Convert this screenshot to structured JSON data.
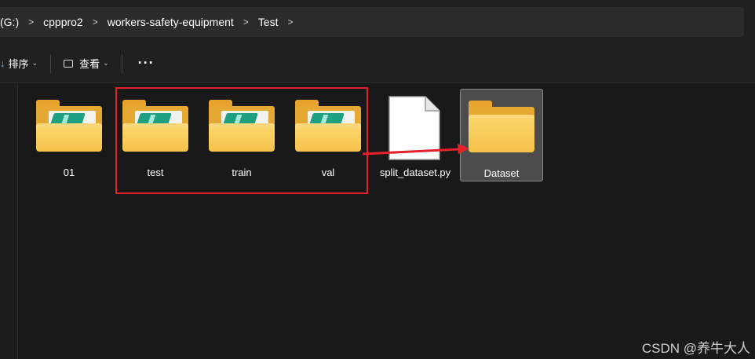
{
  "breadcrumb": {
    "items": [
      "(G:)",
      "cpppro2",
      "workers-safety-equipment",
      "Test"
    ],
    "separator": ">"
  },
  "toolbar": {
    "sort_label": "排序",
    "sort_icon": "arrow-down-icon",
    "view_label": "查看",
    "view_icon": "view-icon",
    "more_label": "···"
  },
  "files": [
    {
      "name": "01",
      "type": "folder",
      "icon": "folder-icon"
    },
    {
      "name": "test",
      "type": "folder",
      "icon": "folder-icon"
    },
    {
      "name": "train",
      "type": "folder",
      "icon": "folder-icon"
    },
    {
      "name": "val",
      "type": "folder",
      "icon": "folder-icon"
    },
    {
      "name": "split_dataset.py",
      "type": "file",
      "icon": "file-icon"
    },
    {
      "name": "Dataset",
      "type": "folder",
      "icon": "folder-icon",
      "selected": true
    }
  ],
  "annotations": {
    "highlight_color": "#e4202a"
  },
  "watermark": "CSDN @养牛大人"
}
